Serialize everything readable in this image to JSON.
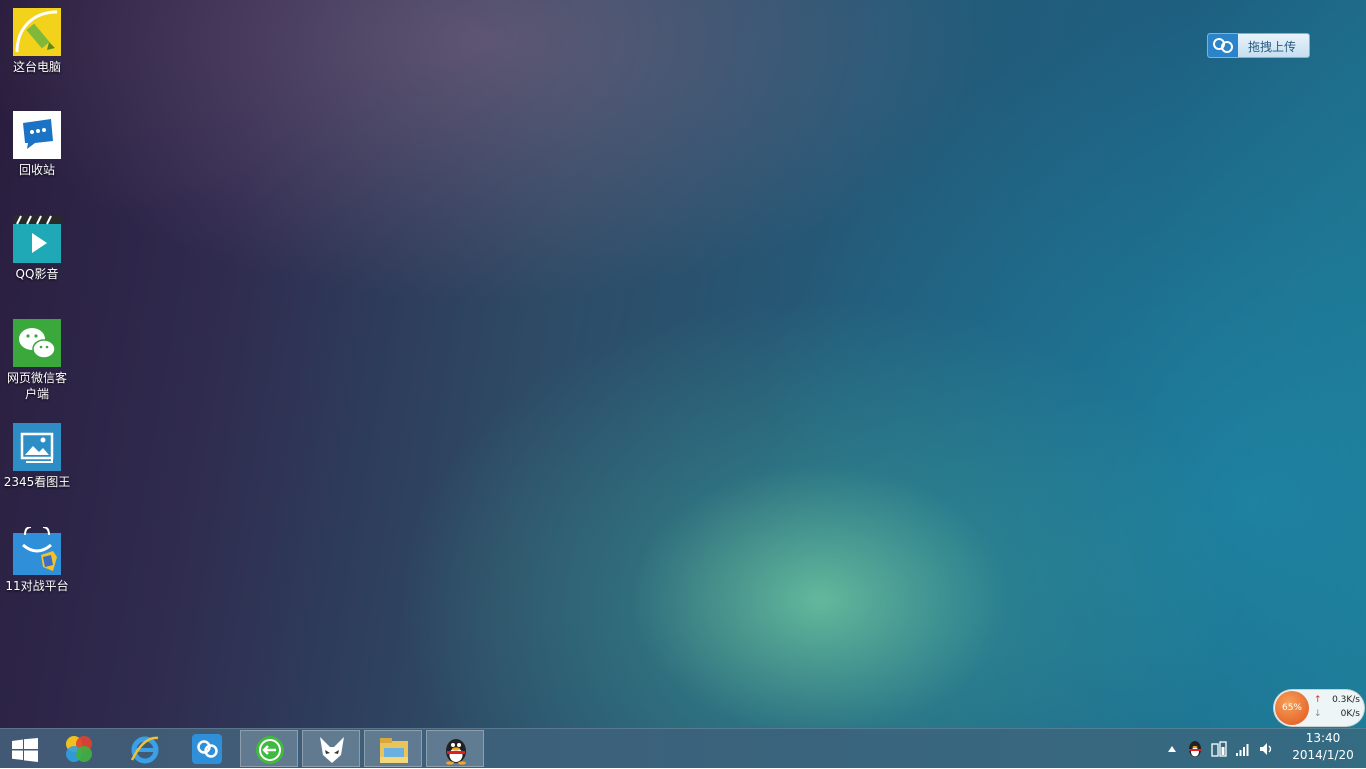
{
  "desktop": {
    "icons": [
      {
        "label": "这台电脑",
        "icon": "computer-icon"
      },
      {
        "label": "回收站",
        "icon": "recycle-bin-icon"
      },
      {
        "label": "QQ影音",
        "icon": "qq-player-icon"
      },
      {
        "label": "网页微信客户端",
        "icon": "wechat-icon"
      },
      {
        "label": "2345看图王",
        "icon": "image-viewer-icon"
      },
      {
        "label": "11对战平台",
        "icon": "battle-platform-icon"
      }
    ],
    "upload_button": {
      "label": "拖拽上传",
      "icon": "cloud-upload-icon"
    }
  },
  "taskbar": {
    "buttons": [
      {
        "name": "start",
        "icon": "windows-logo-icon",
        "active": false
      },
      {
        "name": "browser-2345",
        "icon": "ball-icon",
        "active": false
      },
      {
        "name": "internet-explorer",
        "icon": "ie-icon",
        "active": false
      },
      {
        "name": "baidu-cloud",
        "icon": "cloud-icon",
        "active": false
      },
      {
        "name": "360-browser",
        "icon": "green-e-icon",
        "active": true
      },
      {
        "name": "foobar",
        "icon": "fox-icon",
        "active": true
      },
      {
        "name": "file-explorer",
        "icon": "folder-icon",
        "active": true
      },
      {
        "name": "qq",
        "icon": "penguin-icon",
        "active": true
      }
    ],
    "tray": {
      "icons": [
        "show-hidden-icon",
        "qq-tray-icon",
        "power-icon",
        "network-signal-icon",
        "volume-icon"
      ],
      "time": "13:40",
      "date": "2014/1/20"
    }
  },
  "net_widget": {
    "percent": "65%",
    "upload": "0.3K/s",
    "download": "0K/s"
  },
  "colors": {
    "taskbar": "#2f5a78",
    "accent": "#2b83c9",
    "net_ball": "#e8692a"
  }
}
